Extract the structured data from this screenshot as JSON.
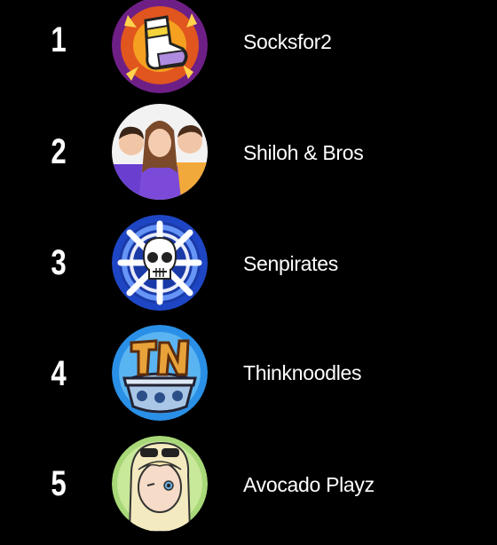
{
  "leaderboard": {
    "entries": [
      {
        "rank": "1",
        "name": "Socksfor2",
        "avatar": "sock-character-icon",
        "accent": "#7a2a8c"
      },
      {
        "rank": "2",
        "name": "Shiloh & Bros",
        "avatar": "group-photo-avatar",
        "accent": "#6a3fd0"
      },
      {
        "rank": "3",
        "name": "Senpirates",
        "avatar": "skull-crossbones-icon",
        "accent": "#1f4fc8"
      },
      {
        "rank": "4",
        "name": "Thinknoodles",
        "avatar": "tn-noodle-bowl-icon",
        "accent": "#2f8fe0"
      },
      {
        "rank": "5",
        "name": "Avocado Playz",
        "avatar": "cartoon-girl-avatar",
        "accent": "#a8d878"
      }
    ]
  }
}
